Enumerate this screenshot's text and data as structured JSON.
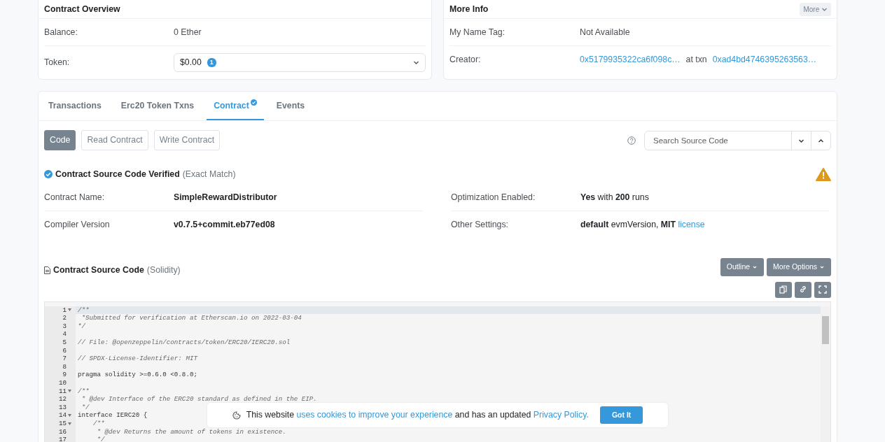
{
  "overview": {
    "title": "Contract Overview",
    "rows": [
      {
        "label": "Balance:",
        "value": "0 Ether"
      }
    ],
    "token": {
      "label": "Token:",
      "value": "$0.00",
      "badge": "1"
    }
  },
  "more_info": {
    "title": "More Info",
    "more_button": "More",
    "name_tag": {
      "label": "My Name Tag:",
      "value": "Not Available"
    },
    "creator": {
      "label": "Creator:",
      "address": "0x5179935322ca6f098c…",
      "between": "at txn",
      "txn": "0xad4bd4746395263563…"
    }
  },
  "tabs": [
    {
      "label": "Transactions",
      "selected": false,
      "verified": false
    },
    {
      "label": "Erc20 Token Txns",
      "selected": false,
      "verified": false
    },
    {
      "label": "Contract",
      "selected": true,
      "verified": true
    },
    {
      "label": "Events",
      "selected": false,
      "verified": false
    }
  ],
  "subtabs": [
    {
      "label": "Code",
      "selected": true
    },
    {
      "label": "Read Contract",
      "selected": false
    },
    {
      "label": "Write Contract",
      "selected": false
    }
  ],
  "search": {
    "placeholder": "Search Source Code"
  },
  "verified": {
    "title": "Contract Source Code Verified",
    "note": "(Exact Match)"
  },
  "details": [
    {
      "label": "Contract Name:",
      "value": "SimpleRewardDistributor"
    },
    {
      "label": "Optimization Enabled:",
      "value": "**Yes** with **200** runs"
    },
    {
      "label": "Compiler Version",
      "value": "v0.7.5+commit.eb77ed08"
    },
    {
      "label": "Other Settings:",
      "value": "**default** evmVersion, **MIT**",
      "link": "license"
    }
  ],
  "source": {
    "title": "Contract Source Code",
    "language": "(Solidity)",
    "buttons": [
      "Outline",
      "More Options"
    ]
  },
  "code_lines": [
    {
      "number": "1",
      "fold": true,
      "kind": "comment",
      "text": "/**"
    },
    {
      "number": "2",
      "fold": false,
      "kind": "comment",
      "text": " *Submitted for verification at Etherscan.io on 2022-03-04"
    },
    {
      "number": "3",
      "fold": false,
      "kind": "comment",
      "text": "*/"
    },
    {
      "number": "4",
      "fold": false,
      "kind": "blank"
    },
    {
      "number": "5",
      "fold": false,
      "kind": "comment",
      "text": "// File: @openzeppelin/contracts/token/ERC20/IERC20.sol"
    },
    {
      "number": "6",
      "fold": false,
      "kind": "blank"
    },
    {
      "number": "7",
      "fold": false,
      "kind": "comment",
      "text": "// SPDX-License-Identifier: MIT"
    },
    {
      "number": "8",
      "fold": false,
      "kind": "blank"
    },
    {
      "number": "9",
      "fold": false,
      "kind": "code",
      "text": "pragma solidity >=0.6.0 <0.8.0;"
    },
    {
      "number": "10",
      "fold": false,
      "kind": "blank"
    },
    {
      "number": "11",
      "fold": true,
      "kind": "comment",
      "text": "/**"
    },
    {
      "number": "12",
      "fold": false,
      "kind": "comment",
      "text": " * @dev Interface of the ERC20 standard as defined in the EIP."
    },
    {
      "number": "13",
      "fold": false,
      "kind": "comment",
      "text": " */"
    },
    {
      "number": "14",
      "fold": true,
      "kind": "code",
      "text": "interface IERC20 {"
    },
    {
      "number": "15",
      "fold": true,
      "kind": "comment",
      "text": "    /**"
    },
    {
      "number": "16",
      "fold": false,
      "kind": "comment",
      "text": "     * @dev Returns the amount of tokens in existence."
    },
    {
      "number": "17",
      "fold": false,
      "kind": "comment",
      "text": "     */"
    }
  ],
  "cookie": {
    "before": "This website",
    "link": "uses cookies to improve your experience",
    "middle": "and has an updated",
    "policy": "Privacy Policy.",
    "button": "Got It"
  }
}
